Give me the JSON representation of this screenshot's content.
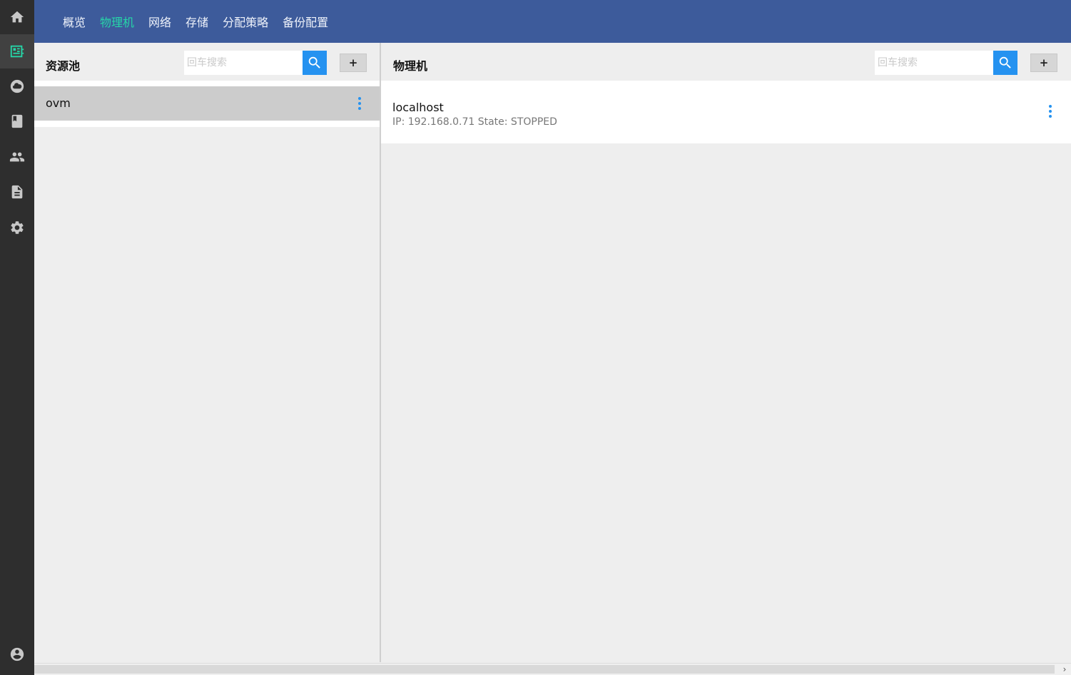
{
  "nav": {
    "items": [
      {
        "label": "概览",
        "active": false
      },
      {
        "label": "物理机",
        "active": true
      },
      {
        "label": "网络",
        "active": false
      },
      {
        "label": "存储",
        "active": false
      },
      {
        "label": "分配策略",
        "active": false
      },
      {
        "label": "备份配置",
        "active": false
      }
    ],
    "active_color": "#26d6a8",
    "bar_color": "#3d5b9b"
  },
  "sidebar": {
    "icons": [
      "home-icon",
      "server-board-icon",
      "cloud-icon",
      "book-icon",
      "people-icon",
      "document-icon",
      "gear-icon",
      "account-circle-icon"
    ],
    "active_icon": "server-board-icon"
  },
  "pool_panel": {
    "title": "资源池",
    "search_placeholder": "回车搜索",
    "add_label": "+",
    "items": [
      {
        "name": "ovm"
      }
    ]
  },
  "host_panel": {
    "title": "物理机",
    "search_placeholder": "回车搜索",
    "add_label": "+",
    "items": [
      {
        "name": "localhost",
        "meta": "IP: 192.168.0.71 State: STOPPED"
      }
    ]
  },
  "scrollbar": {
    "arrow": "›"
  }
}
